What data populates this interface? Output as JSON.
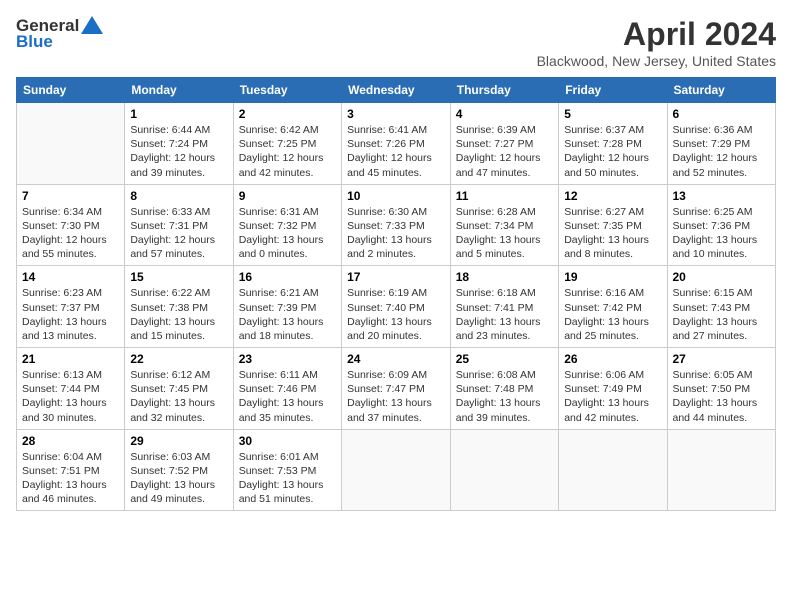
{
  "header": {
    "logo_general": "General",
    "logo_blue": "Blue",
    "month": "April 2024",
    "location": "Blackwood, New Jersey, United States"
  },
  "weekdays": [
    "Sunday",
    "Monday",
    "Tuesday",
    "Wednesday",
    "Thursday",
    "Friday",
    "Saturday"
  ],
  "weeks": [
    [
      {
        "day": "",
        "sunrise": "",
        "sunset": "",
        "daylight": ""
      },
      {
        "day": "1",
        "sunrise": "Sunrise: 6:44 AM",
        "sunset": "Sunset: 7:24 PM",
        "daylight": "Daylight: 12 hours and 39 minutes."
      },
      {
        "day": "2",
        "sunrise": "Sunrise: 6:42 AM",
        "sunset": "Sunset: 7:25 PM",
        "daylight": "Daylight: 12 hours and 42 minutes."
      },
      {
        "day": "3",
        "sunrise": "Sunrise: 6:41 AM",
        "sunset": "Sunset: 7:26 PM",
        "daylight": "Daylight: 12 hours and 45 minutes."
      },
      {
        "day": "4",
        "sunrise": "Sunrise: 6:39 AM",
        "sunset": "Sunset: 7:27 PM",
        "daylight": "Daylight: 12 hours and 47 minutes."
      },
      {
        "day": "5",
        "sunrise": "Sunrise: 6:37 AM",
        "sunset": "Sunset: 7:28 PM",
        "daylight": "Daylight: 12 hours and 50 minutes."
      },
      {
        "day": "6",
        "sunrise": "Sunrise: 6:36 AM",
        "sunset": "Sunset: 7:29 PM",
        "daylight": "Daylight: 12 hours and 52 minutes."
      }
    ],
    [
      {
        "day": "7",
        "sunrise": "Sunrise: 6:34 AM",
        "sunset": "Sunset: 7:30 PM",
        "daylight": "Daylight: 12 hours and 55 minutes."
      },
      {
        "day": "8",
        "sunrise": "Sunrise: 6:33 AM",
        "sunset": "Sunset: 7:31 PM",
        "daylight": "Daylight: 12 hours and 57 minutes."
      },
      {
        "day": "9",
        "sunrise": "Sunrise: 6:31 AM",
        "sunset": "Sunset: 7:32 PM",
        "daylight": "Daylight: 13 hours and 0 minutes."
      },
      {
        "day": "10",
        "sunrise": "Sunrise: 6:30 AM",
        "sunset": "Sunset: 7:33 PM",
        "daylight": "Daylight: 13 hours and 2 minutes."
      },
      {
        "day": "11",
        "sunrise": "Sunrise: 6:28 AM",
        "sunset": "Sunset: 7:34 PM",
        "daylight": "Daylight: 13 hours and 5 minutes."
      },
      {
        "day": "12",
        "sunrise": "Sunrise: 6:27 AM",
        "sunset": "Sunset: 7:35 PM",
        "daylight": "Daylight: 13 hours and 8 minutes."
      },
      {
        "day": "13",
        "sunrise": "Sunrise: 6:25 AM",
        "sunset": "Sunset: 7:36 PM",
        "daylight": "Daylight: 13 hours and 10 minutes."
      }
    ],
    [
      {
        "day": "14",
        "sunrise": "Sunrise: 6:23 AM",
        "sunset": "Sunset: 7:37 PM",
        "daylight": "Daylight: 13 hours and 13 minutes."
      },
      {
        "day": "15",
        "sunrise": "Sunrise: 6:22 AM",
        "sunset": "Sunset: 7:38 PM",
        "daylight": "Daylight: 13 hours and 15 minutes."
      },
      {
        "day": "16",
        "sunrise": "Sunrise: 6:21 AM",
        "sunset": "Sunset: 7:39 PM",
        "daylight": "Daylight: 13 hours and 18 minutes."
      },
      {
        "day": "17",
        "sunrise": "Sunrise: 6:19 AM",
        "sunset": "Sunset: 7:40 PM",
        "daylight": "Daylight: 13 hours and 20 minutes."
      },
      {
        "day": "18",
        "sunrise": "Sunrise: 6:18 AM",
        "sunset": "Sunset: 7:41 PM",
        "daylight": "Daylight: 13 hours and 23 minutes."
      },
      {
        "day": "19",
        "sunrise": "Sunrise: 6:16 AM",
        "sunset": "Sunset: 7:42 PM",
        "daylight": "Daylight: 13 hours and 25 minutes."
      },
      {
        "day": "20",
        "sunrise": "Sunrise: 6:15 AM",
        "sunset": "Sunset: 7:43 PM",
        "daylight": "Daylight: 13 hours and 27 minutes."
      }
    ],
    [
      {
        "day": "21",
        "sunrise": "Sunrise: 6:13 AM",
        "sunset": "Sunset: 7:44 PM",
        "daylight": "Daylight: 13 hours and 30 minutes."
      },
      {
        "day": "22",
        "sunrise": "Sunrise: 6:12 AM",
        "sunset": "Sunset: 7:45 PM",
        "daylight": "Daylight: 13 hours and 32 minutes."
      },
      {
        "day": "23",
        "sunrise": "Sunrise: 6:11 AM",
        "sunset": "Sunset: 7:46 PM",
        "daylight": "Daylight: 13 hours and 35 minutes."
      },
      {
        "day": "24",
        "sunrise": "Sunrise: 6:09 AM",
        "sunset": "Sunset: 7:47 PM",
        "daylight": "Daylight: 13 hours and 37 minutes."
      },
      {
        "day": "25",
        "sunrise": "Sunrise: 6:08 AM",
        "sunset": "Sunset: 7:48 PM",
        "daylight": "Daylight: 13 hours and 39 minutes."
      },
      {
        "day": "26",
        "sunrise": "Sunrise: 6:06 AM",
        "sunset": "Sunset: 7:49 PM",
        "daylight": "Daylight: 13 hours and 42 minutes."
      },
      {
        "day": "27",
        "sunrise": "Sunrise: 6:05 AM",
        "sunset": "Sunset: 7:50 PM",
        "daylight": "Daylight: 13 hours and 44 minutes."
      }
    ],
    [
      {
        "day": "28",
        "sunrise": "Sunrise: 6:04 AM",
        "sunset": "Sunset: 7:51 PM",
        "daylight": "Daylight: 13 hours and 46 minutes."
      },
      {
        "day": "29",
        "sunrise": "Sunrise: 6:03 AM",
        "sunset": "Sunset: 7:52 PM",
        "daylight": "Daylight: 13 hours and 49 minutes."
      },
      {
        "day": "30",
        "sunrise": "Sunrise: 6:01 AM",
        "sunset": "Sunset: 7:53 PM",
        "daylight": "Daylight: 13 hours and 51 minutes."
      },
      {
        "day": "",
        "sunrise": "",
        "sunset": "",
        "daylight": ""
      },
      {
        "day": "",
        "sunrise": "",
        "sunset": "",
        "daylight": ""
      },
      {
        "day": "",
        "sunrise": "",
        "sunset": "",
        "daylight": ""
      },
      {
        "day": "",
        "sunrise": "",
        "sunset": "",
        "daylight": ""
      }
    ]
  ]
}
